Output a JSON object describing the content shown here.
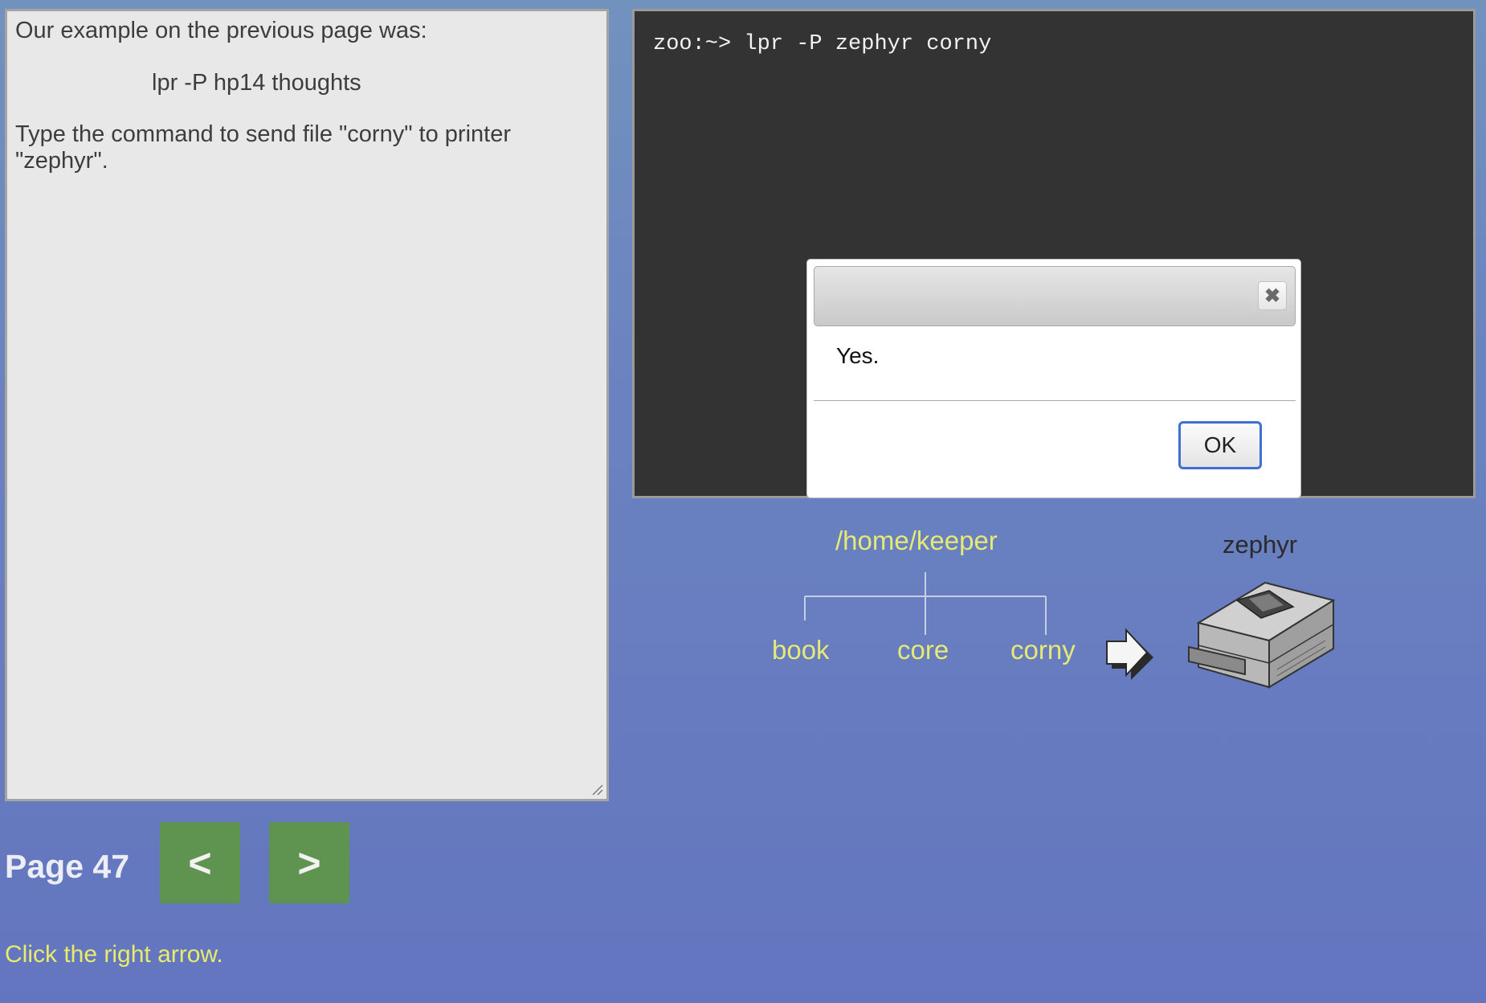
{
  "lesson": {
    "intro": "Our example on the previous page was:",
    "example": "lpr -P hp14 thoughts",
    "task": "Type the command to send file \"corny\" to printer \"zephyr\"."
  },
  "terminal": {
    "command_line": "zoo:~> lpr -P zephyr corny"
  },
  "dialog": {
    "message": "Yes.",
    "ok_label": "OK",
    "close_glyph": "✖"
  },
  "diagram": {
    "directory": "/home/keeper",
    "files": [
      "book",
      "core",
      "corny"
    ],
    "printer": "zephyr"
  },
  "nav": {
    "page_label": "Page 47",
    "prev_label": "<",
    "next_label": ">"
  },
  "hint": "Click the right arrow.",
  "colors": {
    "nav_button": "#5f9450",
    "diagram_text": "#e6ea74",
    "terminal_bg": "#333333"
  }
}
